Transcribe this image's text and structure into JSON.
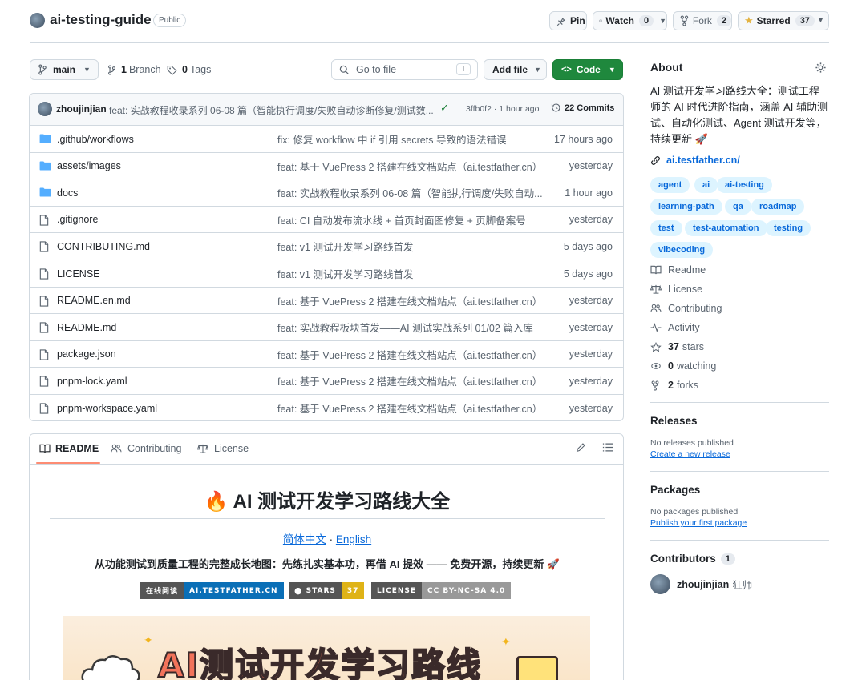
{
  "repo": {
    "name": "ai-testing-guide",
    "visibility": "Public"
  },
  "actions": {
    "pin": "Pin",
    "watch": "Watch",
    "watch_count": "0",
    "fork": "Fork",
    "fork_count": "2",
    "starred": "Starred",
    "star_count": "37"
  },
  "toolbar": {
    "branch": "main",
    "branches_count": "1",
    "branches_label": "Branch",
    "tags_count": "0",
    "tags_label": "Tags",
    "goto_placeholder": "Go to file",
    "goto_kbd": "T",
    "add_file": "Add file",
    "code": "Code"
  },
  "commit": {
    "author": "zhoujinjian",
    "message": "feat: 实战教程收录系列 06-08 篇（智能执行调度/失败自动诊断修复/测试数...",
    "hash_time": "3ffb0f2 · 1 hour ago",
    "commits": "22 Commits"
  },
  "files": [
    {
      "type": "dir",
      "name": ".github/workflows",
      "message": "fix: 修复 workflow 中 if 引用 secrets 导致的语法错误",
      "date": "17 hours ago"
    },
    {
      "type": "dir",
      "name": "assets/images",
      "message": "feat: 基于 VuePress 2 搭建在线文档站点（ai.testfather.cn）",
      "date": "yesterday"
    },
    {
      "type": "dir",
      "name": "docs",
      "message": "feat: 实战教程收录系列 06-08 篇（智能执行调度/失败自动...",
      "date": "1 hour ago"
    },
    {
      "type": "file",
      "name": ".gitignore",
      "message": "feat: CI 自动发布流水线 + 首页封面图修复 + 页脚备案号",
      "date": "yesterday"
    },
    {
      "type": "file",
      "name": "CONTRIBUTING.md",
      "message": "feat: v1 测试开发学习路线首发",
      "date": "5 days ago"
    },
    {
      "type": "file",
      "name": "LICENSE",
      "message": "feat: v1 测试开发学习路线首发",
      "date": "5 days ago"
    },
    {
      "type": "file",
      "name": "README.en.md",
      "message": "feat: 基于 VuePress 2 搭建在线文档站点（ai.testfather.cn）",
      "date": "yesterday"
    },
    {
      "type": "file",
      "name": "README.md",
      "message": "feat: 实战教程板块首发——AI 测试实战系列 01/02 篇入库",
      "date": "yesterday"
    },
    {
      "type": "file",
      "name": "package.json",
      "message": "feat: 基于 VuePress 2 搭建在线文档站点（ai.testfather.cn）",
      "date": "yesterday"
    },
    {
      "type": "file",
      "name": "pnpm-lock.yaml",
      "message": "feat: 基于 VuePress 2 搭建在线文档站点（ai.testfather.cn）",
      "date": "yesterday"
    },
    {
      "type": "file",
      "name": "pnpm-workspace.yaml",
      "message": "feat: 基于 VuePress 2 搭建在线文档站点（ai.testfather.cn）",
      "date": "yesterday"
    }
  ],
  "readme_tabs": {
    "readme": "README",
    "contributing": "Contributing",
    "license": "License"
  },
  "readme": {
    "title_emoji": "🔥",
    "title": "AI 测试开发学习路线大全",
    "lang_zh": "简体中文",
    "lang_sep": " · ",
    "lang_en": "English",
    "tagline": "从功能测试到质量工程的完整成长地图：先练扎实基本功，再借 AI 提效 —— 免费开源，持续更新 🚀",
    "badges": {
      "read_label": "在线阅读",
      "read_value": "AI.TESTFATHER.CN",
      "stars_label": "STARS",
      "stars_value": "37",
      "license_label": "LICENSE",
      "license_value": "CC BY-NC-SA 4.0"
    },
    "banner_text": "AI测试开发学习路线"
  },
  "about": {
    "heading": "About",
    "description": "AI 测试开发学习路线大全：测试工程师的 AI 时代进阶指南，涵盖 AI 辅助测试、自动化测试、Agent 测试开发等，持续更新 🚀",
    "website": "ai.testfather.cn/",
    "topics": [
      "agent",
      "ai",
      "ai-testing",
      "learning-path",
      "qa",
      "roadmap",
      "test",
      "test-automation",
      "testing",
      "vibecoding"
    ],
    "links": {
      "readme": "Readme",
      "license": "License",
      "contributing": "Contributing",
      "activity": "Activity",
      "stars_count": "37",
      "stars": "stars",
      "watching_count": "0",
      "watching": "watching",
      "forks_count": "2",
      "forks": "forks"
    }
  },
  "releases": {
    "heading": "Releases",
    "empty": "No releases published",
    "create": "Create a new release"
  },
  "packages": {
    "heading": "Packages",
    "empty": "No packages published",
    "publish": "Publish your first package"
  },
  "contributors": {
    "heading": "Contributors",
    "count": "1",
    "user": "zhoujinjian",
    "user_note": "狂师"
  },
  "colors": {
    "accent": "#0969da",
    "code_button": "#1f883d",
    "star_yellow": "#e3b341",
    "topic_bg": "#ddf4ff"
  }
}
